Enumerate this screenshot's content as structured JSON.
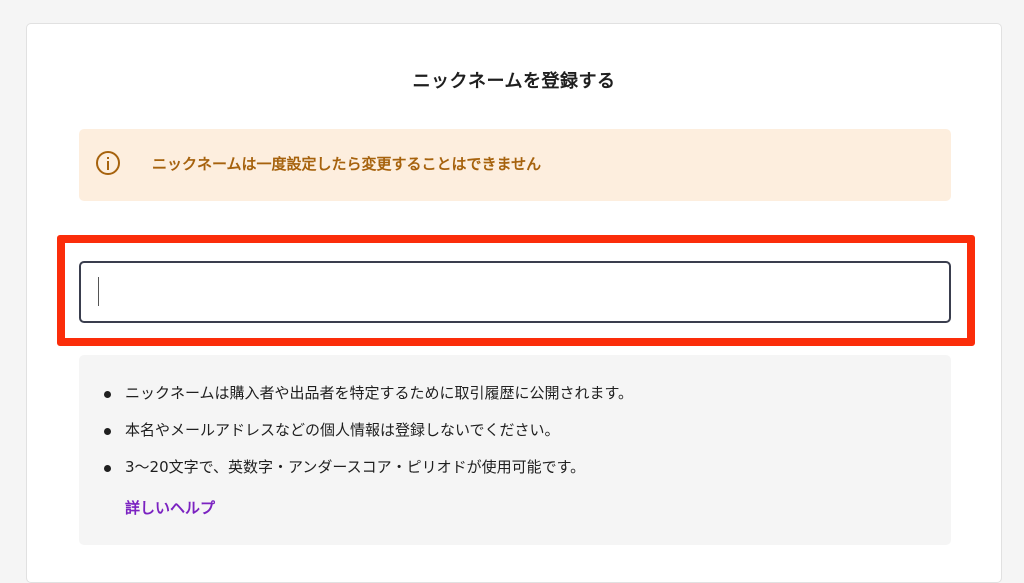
{
  "page": {
    "title": "ニックネームを登録する"
  },
  "notice": {
    "icon": "info-icon",
    "text": "ニックネームは一度設定したら変更することはできません",
    "color": "#a6620d",
    "background": "#fdeede"
  },
  "input": {
    "value": "",
    "placeholder": ""
  },
  "highlight": {
    "color": "#fb2d0a"
  },
  "guidelines": {
    "items": [
      "ニックネームは購入者や出品者を特定するために取引履歴に公開されます。",
      "本名やメールアドレスなどの個人情報は登録しないでください。",
      "3〜20文字で、英数字・アンダースコア・ピリオドが使用可能です。"
    ],
    "help_link": "詳しいヘルプ",
    "link_color": "#7b22c1"
  }
}
